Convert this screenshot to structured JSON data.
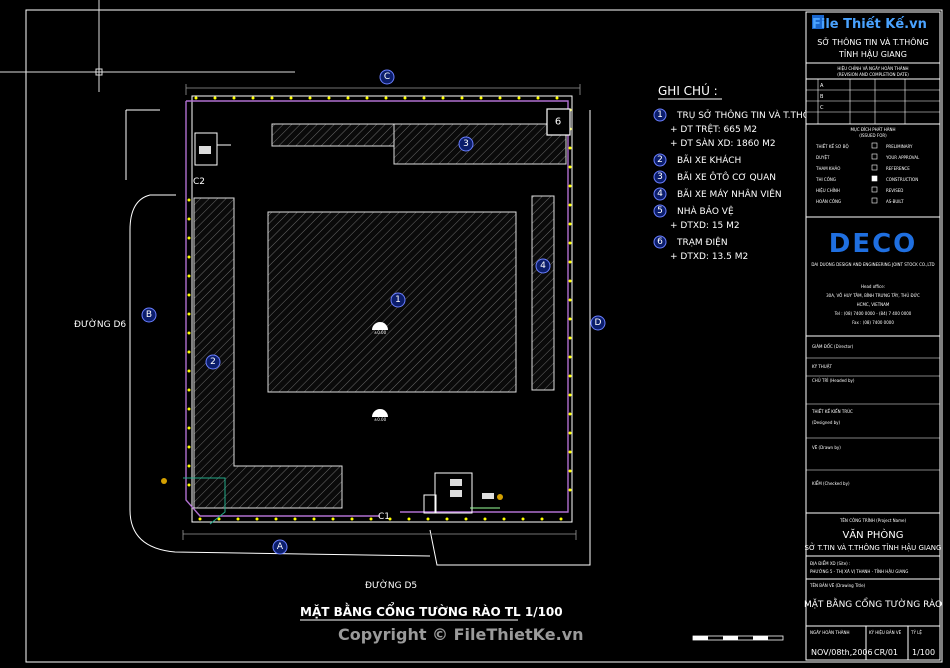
{
  "watermark": {
    "logo_text": "File Thiết Kế.vn",
    "copyright": "Copyright © FileThietKe.vn"
  },
  "plan": {
    "title": "MẶT BẰNG CỔNG TƯỜNG RÀO TL 1/100",
    "road_left": "ĐƯỜNG D6",
    "road_bottom": "ĐƯỜNG D5",
    "axis_labels": {
      "top": "C",
      "left": "B",
      "right": "D",
      "bottom": "A"
    },
    "gate_labels": {
      "c1": "C1",
      "c2": "C2"
    },
    "zone_labels": [
      "1",
      "2",
      "3",
      "4",
      "6"
    ],
    "level_mark": "±0.00"
  },
  "notes": {
    "heading": "GHI CHÚ :",
    "items": [
      {
        "num": "1",
        "text": "TRỤ SỞ THÔNG TIN VÀ T.THÔNG",
        "subs": [
          "+ DT TRỆT: 665 M2",
          "+ DT SÀN XD: 1860 M2"
        ]
      },
      {
        "num": "2",
        "text": "BÃI XE KHÁCH",
        "subs": []
      },
      {
        "num": "3",
        "text": "BÃI XE ÔTÔ CƠ QUAN",
        "subs": []
      },
      {
        "num": "4",
        "text": "BÃI XE MÁY NHÂN VIÊN",
        "subs": []
      },
      {
        "num": "5",
        "text": "NHÀ BẢO VỆ",
        "subs": [
          "+ DTXD: 15 M2"
        ]
      },
      {
        "num": "6",
        "text": "TRẠM ĐIỆN",
        "subs": [
          "+ DTXD: 13.5 M2"
        ]
      }
    ]
  },
  "titleblock": {
    "owner_line1": "SỞ THÔNG TIN VÀ T.THÔNG",
    "owner_line2": "TỈNH HẬU GIANG",
    "revision_header": "HIỆU CHỈNH VÀ NGÀY HOÀN THÀNH",
    "revision_header_en": "(REVISION AND COMPLETION DATE)",
    "revisions": [
      "A",
      "B",
      "C"
    ],
    "status_header": "MỤC ĐÍCH PHÁT HÀNH",
    "status_header_en": "(ISSUED FOR)",
    "status": [
      {
        "vi": "THIẾT KẾ SƠ BỘ",
        "en": "PRELIMINARY"
      },
      {
        "vi": "DUYỆT",
        "en": "YOUR APPROVAL"
      },
      {
        "vi": "THAM KHẢO",
        "en": "REFERENCE"
      },
      {
        "vi": "THI CÔNG",
        "en": "CONSTRUCTION"
      },
      {
        "vi": "HIỆU CHỈNH",
        "en": "REVISED"
      },
      {
        "vi": "HOÀN CÔNG",
        "en": "AS-BUILT"
      }
    ],
    "firm_logo": "DECO",
    "firm_name": "DAI DUONG DESIGN AND ENGINEERING JOINT STOCK CO.,LTD",
    "firm_address": [
      "Head office:",
      "30A, VÕ HUY TÂM, BÌNH TRƯNG TÂY, THỦ ĐỨC",
      "HCMC, VIETNAM",
      "Tel : (08) 7400 0000 - (84) 7 400 0000",
      "Fax : (08) 7400 0000"
    ],
    "roles": [
      "GIÁM ĐỐC (Director)",
      "KỸ THUẬT",
      "CHỦ TRÌ (Headed by)",
      "THIẾT KẾ KIẾN TRÚC",
      "(Designed by)",
      "VẼ (Drawn by)",
      "KIỂM (Checked by)"
    ],
    "project_label": "TÊN CÔNG TRÌNH (Project Name)",
    "project_line1": "VĂN PHÒNG",
    "project_line2": "SỞ T.TIN VÀ T.THÔNG TỈNH HẬU GIANG",
    "location_label": "ĐỊA ĐIỂM XD (Site) :",
    "location": "PHƯỜNG 5 - THỊ XÃ VỊ THANH - TỈNH HẬU GIANG",
    "drawing_label": "TÊN BẢN VẼ (Drawing Title)",
    "drawing_title": "MẶT BẰNG CỔNG TƯỜNG RÀO",
    "bottom_labels": [
      "NGÀY HOÀN THÀNH",
      "KÝ HIỆU BẢN VẼ",
      "TỶ LỆ"
    ],
    "date": "NOV/08th,2006",
    "sheet": "CR/01",
    "scale": "1/100"
  }
}
